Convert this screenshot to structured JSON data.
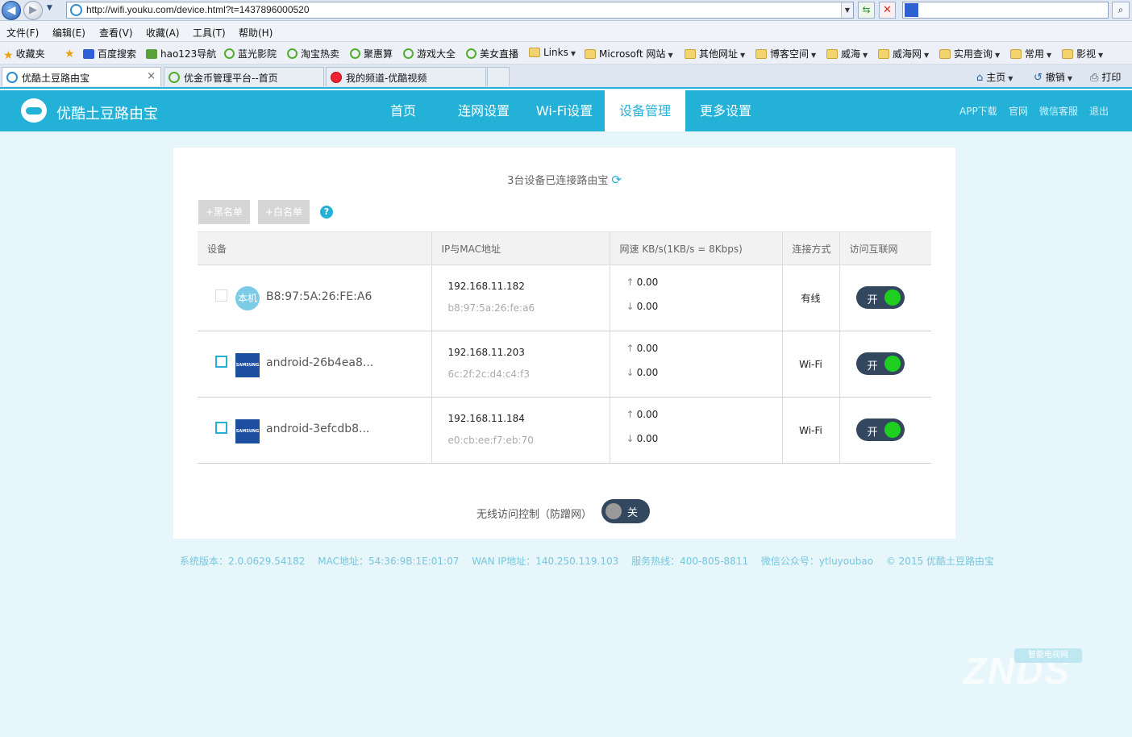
{
  "browser": {
    "url": "http://wifi.youku.com/device.html?t=1437896000520",
    "menu": [
      "文件(F)",
      "编辑(E)",
      "查看(V)",
      "收藏(A)",
      "工具(T)",
      "帮助(H)"
    ],
    "favorites_label": "收藏夹",
    "favorites": [
      "百度搜索",
      "hao123导航",
      "蓝光影院",
      "淘宝热卖",
      "聚惠算",
      "游戏大全",
      "美女直播",
      "Links",
      "Microsoft 网站",
      "其他网址",
      "博客空间",
      "威海",
      "威海网",
      "实用查询",
      "常用",
      "影视"
    ],
    "tabs": [
      "优酷土豆路由宝",
      "优金币管理平台--首页",
      "我的频道-优酷视频"
    ],
    "commands": {
      "home": "主页",
      "undo": "撤销",
      "print": "打印"
    }
  },
  "brand": {
    "name": "优酷土豆路由宝",
    "color": "#23b1d8"
  },
  "nav": {
    "items": [
      "首页",
      "连网设置",
      "Wi-Fi设置",
      "设备管理",
      "更多设置"
    ],
    "active_index": 3
  },
  "top_links": [
    "APP下载",
    "官网",
    "微信客服",
    "退出"
  ],
  "devices_summary": "3台设备已连接路由宝",
  "buttons": {
    "blacklist": "+黑名单",
    "whitelist": "+白名单"
  },
  "table": {
    "headers": [
      "设备",
      "IP与MAC地址",
      "网速 KB/s(1KB/s = 8Kbps)",
      "连接方式",
      "访问互联网"
    ],
    "rows": [
      {
        "icon": "本机",
        "name": "B8:97:5A:26:FE:A6",
        "ip": "192.168.11.182",
        "mac": "b8:97:5a:26:fe:a6",
        "up": "0.00",
        "down": "0.00",
        "conn": "有线",
        "access": "开"
      },
      {
        "icon": "SAMSUNG",
        "name": "android-26b4ea8...",
        "ip": "192.168.11.203",
        "mac": "6c:2f:2c:d4:c4:f3",
        "up": "0.00",
        "down": "0.00",
        "conn": "Wi-Fi",
        "access": "开"
      },
      {
        "icon": "SAMSUNG",
        "name": "android-3efcdb8...",
        "ip": "192.168.11.184",
        "mac": "e0:cb:ee:f7:eb:70",
        "up": "0.00",
        "down": "0.00",
        "conn": "Wi-Fi",
        "access": "开"
      }
    ]
  },
  "wireless_control": {
    "label": "无线访问控制（防蹭网）",
    "state": "关"
  },
  "footer": [
    "系统版本：2.0.0629.54182",
    "MAC地址：54:36:9B:1E:01:07",
    "WAN IP地址：140.250.119.103",
    "服务热线：400-805-8811",
    "微信公众号：ytluyoubao",
    "© 2015 优酷土豆路由宝"
  ],
  "watermark": "ZNDS",
  "watermark_sub": "智能电视网"
}
